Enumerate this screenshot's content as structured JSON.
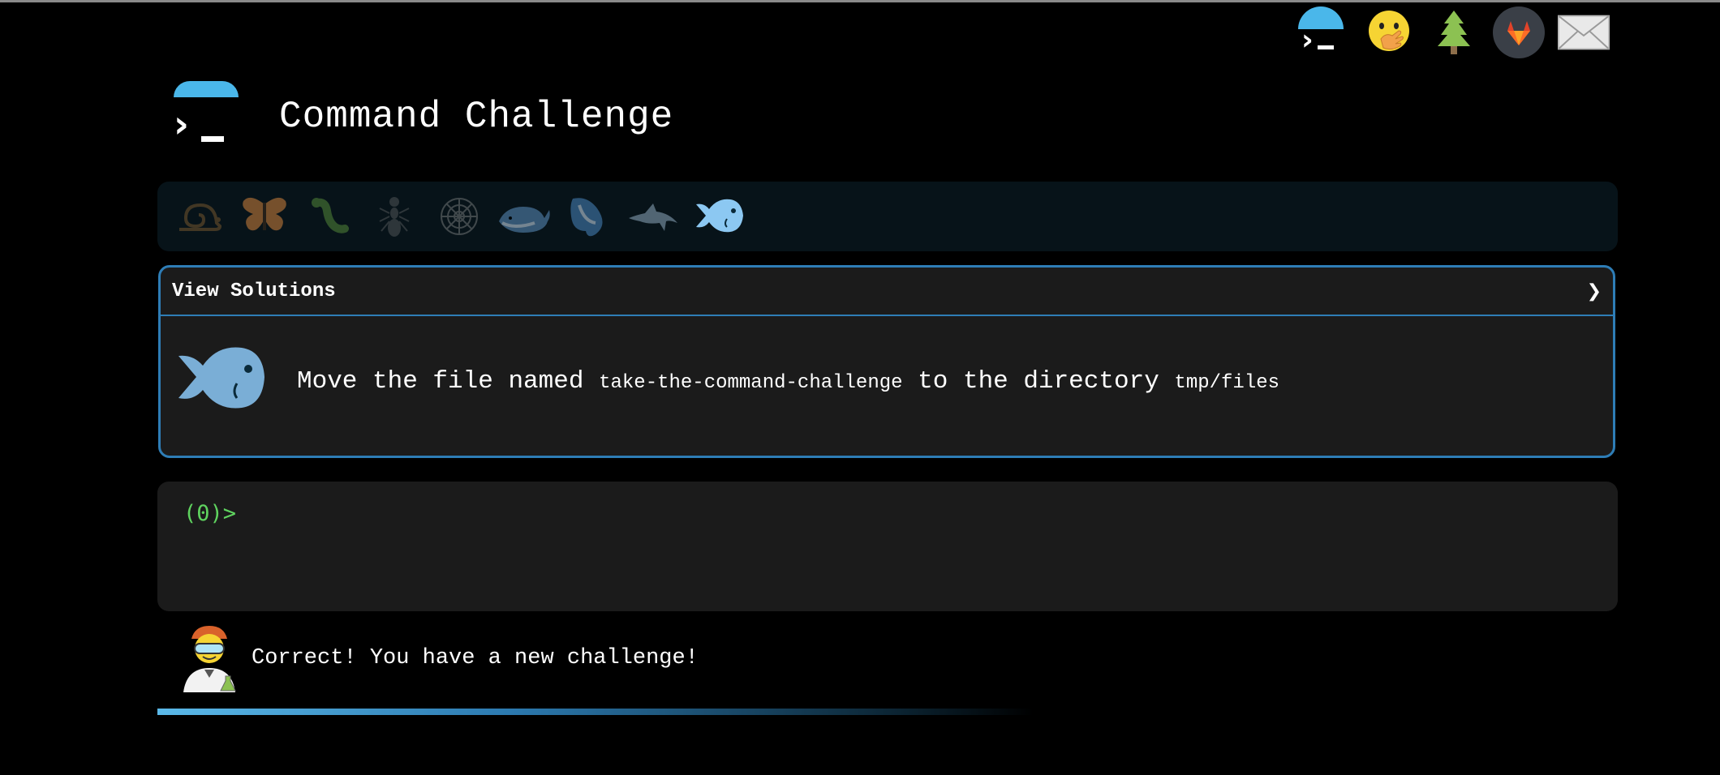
{
  "header": {
    "title": "Command Challenge"
  },
  "top_icons": [
    "terminal-logo-icon",
    "face-with-hand-over-mouth-icon",
    "tree-icon",
    "gitlab-icon",
    "mail-icon"
  ],
  "levels": [
    {
      "name": "snail-icon",
      "state": "completed"
    },
    {
      "name": "butterfly-icon",
      "state": "completed"
    },
    {
      "name": "bug-icon",
      "state": "completed"
    },
    {
      "name": "ant-icon",
      "state": "completed"
    },
    {
      "name": "spider-web-icon",
      "state": "completed"
    },
    {
      "name": "whale-icon",
      "state": "completed"
    },
    {
      "name": "spouting-whale-icon",
      "state": "completed"
    },
    {
      "name": "dolphin-icon",
      "state": "completed"
    },
    {
      "name": "fish-icon",
      "state": "current"
    }
  ],
  "card": {
    "toggle_label": "View Solutions",
    "toggle_chevron": "❯",
    "task_prefix": "Move the file named",
    "file_name": "take-the-command-challenge",
    "task_middle": "to the directory",
    "dir_name": "tmp/files"
  },
  "terminal": {
    "prompt_open": "(",
    "count": "0",
    "prompt_close": ")>"
  },
  "status": {
    "message": "Correct! You have a new challenge!"
  },
  "colors": {
    "accent": "#2e7db6",
    "prompt": "#5fd35f",
    "dome": "#4ab7ea",
    "background": "#000000"
  }
}
